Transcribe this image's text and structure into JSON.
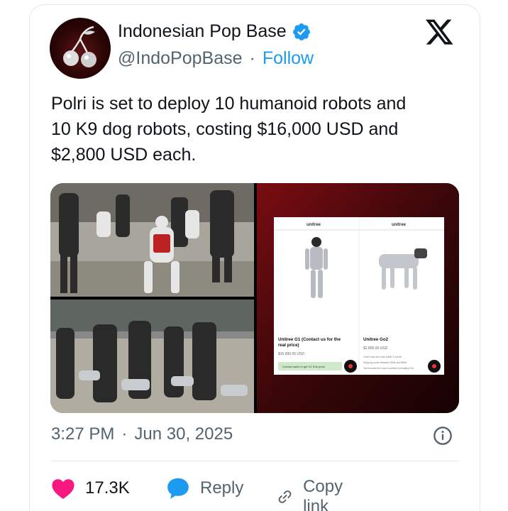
{
  "tweet": {
    "author": {
      "display_name": "Indonesian Pop Base",
      "handle": "@IndoPopBase",
      "separator": "·",
      "follow_label": "Follow",
      "verified": true,
      "avatar_icon": "cherry-icon"
    },
    "text_lines": [
      "Polri is set to deploy 10 humanoid robots and",
      "10 K9 dog robots, costing $16,000 USD and",
      "$2,800 USD each."
    ],
    "media": {
      "product_page": {
        "brand": "unitree",
        "products": [
          {
            "name": "Unitree G1 (Contact us for the",
            "name2": "real price)",
            "price": "$16,000.00 USD",
            "button": "Contact sales to get G1 Edu price"
          },
          {
            "name": "Unitree Go2",
            "price": "$2,800.00 USD",
            "note1": "Order now and ship within 1 month",
            "note2": "Shipping costs between $3## and $5##",
            "note3": "Tax included for most countries (including EU)"
          }
        ]
      }
    },
    "time": "3:27 PM",
    "meta_separator": "·",
    "date": "Jun 30, 2025",
    "likes": "17.3K",
    "reply_label": "Reply",
    "copy_link_label": "Copy link",
    "colors": {
      "accent": "#1d9bf0",
      "like": "#f91880",
      "text": "#0f1419",
      "secondary": "#536471"
    }
  }
}
